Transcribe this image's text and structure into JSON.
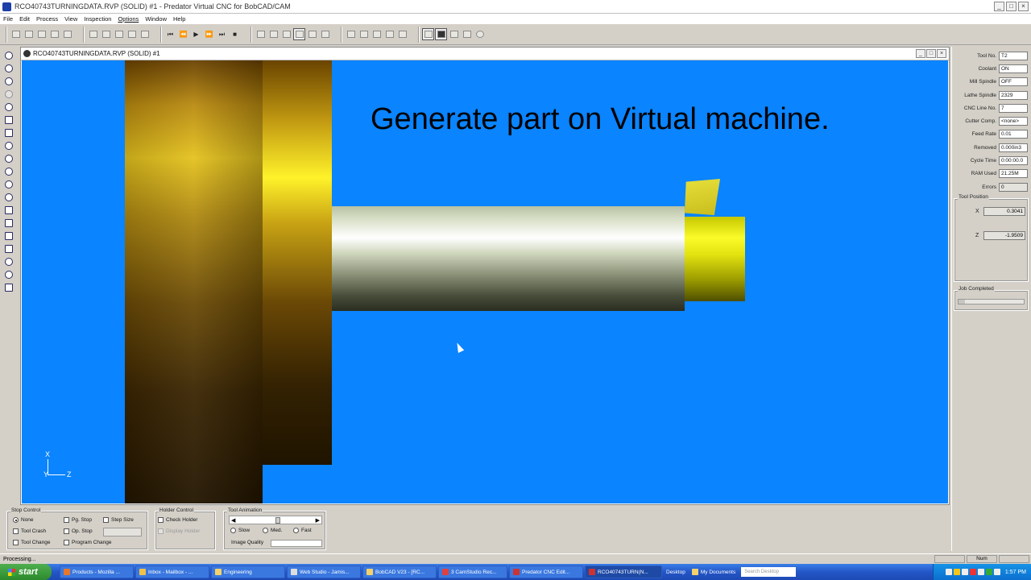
{
  "window": {
    "title": "RCO40743TURNINGDATA.RVP (SOLID) #1 - Predator Virtual CNC for BobCAD/CAM",
    "minimize": "_",
    "maximize": "□",
    "close": "×"
  },
  "menu": [
    "File",
    "Edit",
    "Process",
    "View",
    "Inspection",
    "Options",
    "Window",
    "Help"
  ],
  "document": {
    "title": "RCO40743TURNINGDATA.RVP (SOLID) #1"
  },
  "viewport": {
    "overlay_text": "Generate part on Virtual machine.",
    "axis_x": "X",
    "axis_y": "Y",
    "axis_z": "Z",
    "background_color": "#0a84ff"
  },
  "status_panel": {
    "rows": [
      {
        "label": "Tool No.",
        "value": "T2"
      },
      {
        "label": "Coolant",
        "value": "ON"
      },
      {
        "label": "Mill Spindle",
        "value": "OFF"
      },
      {
        "label": "Lathe Spindle",
        "value": "2329"
      },
      {
        "label": "CNC Line No.",
        "value": "7"
      },
      {
        "label": "Cutter Comp.",
        "value": "<none>"
      },
      {
        "label": "Feed Rate",
        "value": "0.01"
      },
      {
        "label": "Removed",
        "value": "0.000in3"
      },
      {
        "label": "Cycle Time",
        "value": "0:00:00.0"
      },
      {
        "label": "RAM Used",
        "value": "21.25M"
      },
      {
        "label": "Errors",
        "value": "0"
      }
    ],
    "tool_position": {
      "title": "Tool Position",
      "x_label": "X",
      "x_value": "0.3041",
      "z_label": "Z",
      "z_value": "-1.9509"
    },
    "job": {
      "title": "Job Completed",
      "progress": 0.1
    }
  },
  "stop_control": {
    "title": "Stop Control",
    "none": "None",
    "pg_stop": "Pg. Stop",
    "step_size": "Step Size",
    "tool_crash": "Tool Crash",
    "op_stop": "Op. Stop",
    "tool_change": "Tool Change",
    "program_change": "Program Change"
  },
  "holder_control": {
    "title": "Holder Control",
    "check_holder": "Check Holder",
    "display_holder": "Display Holder"
  },
  "tool_animation": {
    "title": "Tool Animation",
    "slow": "Slow",
    "med": "Med.",
    "fast": "Fast",
    "image_quality": "Image Quality"
  },
  "statusbar": {
    "text": "Processing...",
    "num": "Num"
  },
  "taskbar": {
    "start": "start",
    "tasks": [
      "Products - Mozilla ...",
      "Inbox - Mailbox - ...",
      "Engineering",
      "Web Studio - Jamis...",
      "BobCAD V23 - [RC...",
      "3 CamStudio Rec...",
      "Predator CNC Edit...",
      "RCO40743TURN(N...",
      "Desktop",
      "My Documents"
    ],
    "search_placeholder": "Search Desktop",
    "clock": "1:57 PM"
  }
}
